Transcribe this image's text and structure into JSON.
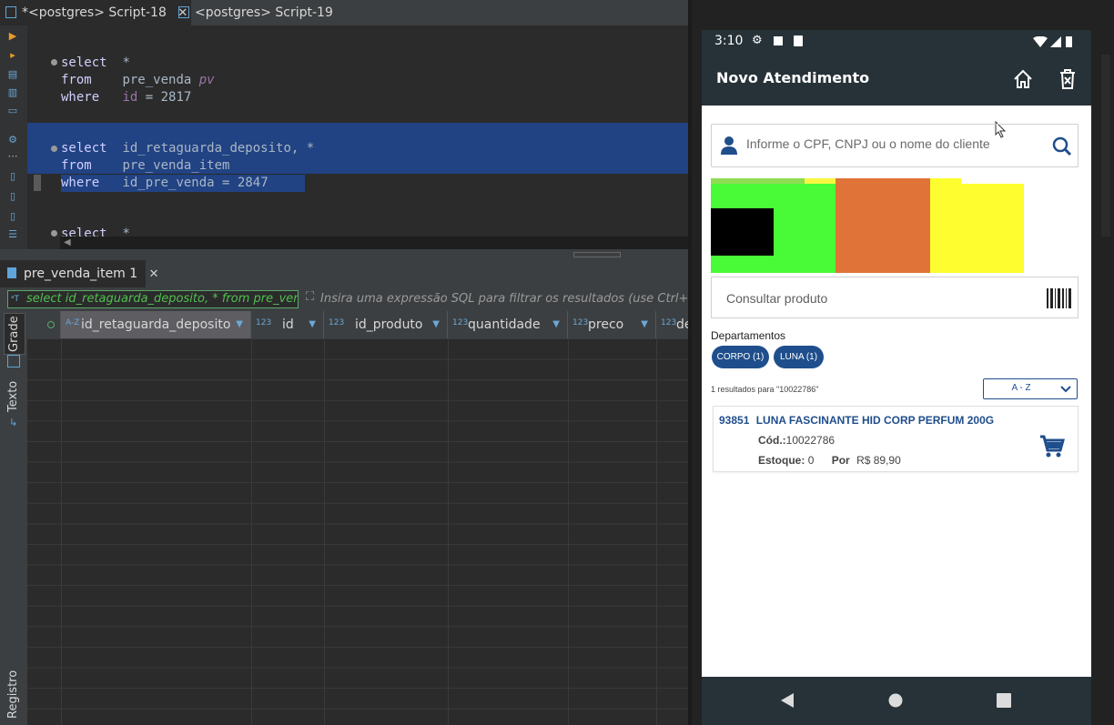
{
  "ide": {
    "tabs": [
      {
        "label": "*<postgres> Script-18",
        "close": "✕"
      },
      {
        "label": "<postgres> Script-19"
      }
    ],
    "sql": {
      "q1": {
        "l1_kw": "select",
        "l1_rest": "*",
        "l2_kw": "from",
        "l2_table": "pre_venda",
        "l2_alias": "pv",
        "l3_kw": "where",
        "l3_col": "id",
        "l3_op": "=",
        "l3_val": "2817"
      },
      "q2": {
        "l1_kw": "select",
        "l1_col": "id_retaguarda_deposito,",
        "l1_star": "*",
        "l2_kw": "from",
        "l2_table": "pre_venda_item",
        "l3_kw": "where",
        "l3_col": "id_pre_venda",
        "l3_op": "=",
        "l3_val": "2847"
      },
      "q3": {
        "l1_kw": "select",
        "l1_rest": "*"
      }
    },
    "results_tab": {
      "label": "pre_venda_item 1",
      "close": "✕"
    },
    "filter": {
      "query": "select id_retaguarda_deposito, * from pre_vend",
      "hint": "Insira uma expressão SQL para filtrar os resultados (use Ctrl+Espaç"
    },
    "side_tabs": {
      "grade": "Grade",
      "texto": "Texto",
      "registro": "Registro"
    },
    "columns": [
      {
        "type": "A-Z",
        "label": "id_retaguarda_deposito"
      },
      {
        "type": "123",
        "label": "id"
      },
      {
        "type": "123",
        "label": "id_produto"
      },
      {
        "type": "123",
        "label": "quantidade"
      },
      {
        "type": "123",
        "label": "preco"
      },
      {
        "type": "123",
        "label": "de"
      }
    ]
  },
  "phone": {
    "status_time": "3:10",
    "title": "Novo Atendimento",
    "client_placeholder": "Informe o CPF, CNPJ ou o nome do cliente",
    "product_placeholder": "Consultar produto",
    "departments_label": "Departamentos",
    "chips": [
      "CORPO (1)",
      "LUNA (1)"
    ],
    "results_text": "1 resultados para \"10022786\"",
    "sort_label": "A - Z",
    "product": {
      "code": "93851",
      "name": "LUNA FASCINANTE HID CORP PERFUM 200G",
      "cod_label": "Cód.:",
      "cod_value": "10022786",
      "stock_label": "Estoque:",
      "stock_value": "0",
      "price_label": "Por",
      "price_value": "R$ 89,90"
    },
    "colors": {
      "bar": "#263238",
      "accent": "#1f4e8c"
    }
  }
}
